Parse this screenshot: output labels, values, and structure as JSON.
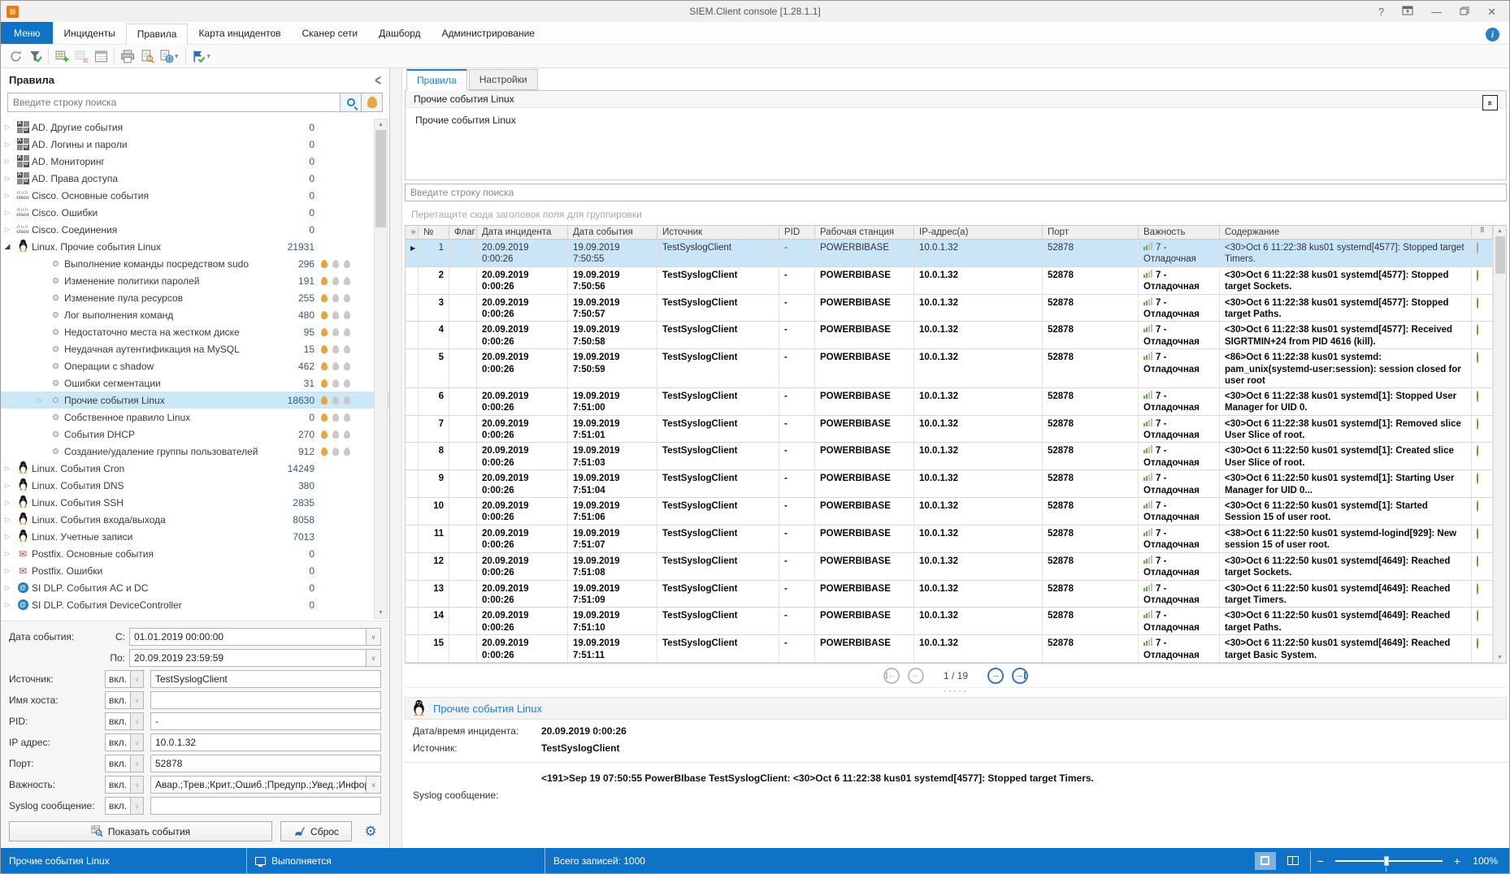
{
  "window": {
    "title": "SIEM.Client console [1.28.1.1]",
    "controls": [
      "help-icon",
      "pin-window-icon",
      "minimize-icon",
      "restore-icon",
      "close-icon"
    ]
  },
  "menu": {
    "tabs": [
      {
        "label": "Меню",
        "kind": "menu"
      },
      {
        "label": "Инциденты"
      },
      {
        "label": "Правила",
        "selected": true
      },
      {
        "label": "Карта инцидентов"
      },
      {
        "label": "Сканер сети"
      },
      {
        "label": "Дашборд"
      },
      {
        "label": "Администрирование"
      }
    ],
    "info_icon": "i"
  },
  "toolbar": {
    "icons": [
      {
        "name": "refresh-icon"
      },
      {
        "name": "filter-check-icon"
      },
      {
        "name": "add-grid-icon",
        "sep_before": true
      },
      {
        "name": "delete-grid-icon",
        "disabled": true
      },
      {
        "name": "card-view-icon"
      },
      {
        "name": "print-icon",
        "sep_before": true
      },
      {
        "name": "print-preview-icon"
      },
      {
        "name": "export-globe-icon",
        "dropdown": true
      },
      {
        "name": "apply-check-icon",
        "sep_before": true,
        "dropdown": true
      }
    ]
  },
  "sidebar": {
    "title": "Правила",
    "search_placeholder": "Введите строку поиска",
    "tree": [
      {
        "label": "AD. Другие события",
        "count": "0",
        "icon": "ad-icon",
        "level": 0,
        "expandable": true
      },
      {
        "label": "AD. Логины и пароли",
        "count": "0",
        "icon": "ad-icon",
        "level": 0,
        "expandable": true
      },
      {
        "label": "AD. Мониторинг",
        "count": "0",
        "icon": "ad-icon",
        "level": 0,
        "expandable": true
      },
      {
        "label": "AD. Права доступа",
        "count": "0",
        "icon": "ad-icon",
        "level": 0,
        "expandable": true
      },
      {
        "label": "Cisco. Основные события",
        "count": "0",
        "icon": "cisco-icon",
        "level": 0,
        "expandable": true
      },
      {
        "label": "Cisco. Ошибки",
        "count": "0",
        "icon": "cisco-icon",
        "level": 0,
        "expandable": true
      },
      {
        "label": "Cisco. Соединения",
        "count": "0",
        "icon": "cisco-icon",
        "level": 0,
        "expandable": true
      },
      {
        "label": "Linux. Прочие события Linux",
        "count": "21931",
        "icon": "linux-icon",
        "level": 0,
        "expandable": true,
        "expanded": true
      },
      {
        "label": "Выполнение команды посредством sudo",
        "count": "296",
        "icon": "rule-dot-icon",
        "level": 1,
        "flames": 1
      },
      {
        "label": "Изменение политики паролей",
        "count": "191",
        "icon": "rule-dot-icon",
        "level": 1,
        "flames": 1
      },
      {
        "label": "Изменение пула ресурсов",
        "count": "255",
        "icon": "rule-dot-icon",
        "level": 1,
        "flames": 1
      },
      {
        "label": "Лог выполнения команд",
        "count": "480",
        "icon": "rule-dot-icon",
        "level": 1,
        "flames": 1
      },
      {
        "label": "Недостаточно места на жестком диске",
        "count": "95",
        "icon": "rule-dot-icon",
        "level": 1,
        "flames": 1
      },
      {
        "label": "Неудачная аутентификация на MySQL",
        "count": "15",
        "icon": "rule-dot-icon",
        "level": 1,
        "flames": 1
      },
      {
        "label": "Операции с shadow",
        "count": "462",
        "icon": "rule-dot-icon",
        "level": 1,
        "flames": 1
      },
      {
        "label": "Ошибки сегментации",
        "count": "31",
        "icon": "rule-dot-icon",
        "level": 1,
        "flames": 1
      },
      {
        "label": "Прочие события Linux",
        "count": "18630",
        "icon": "rule-dot-icon",
        "level": 1,
        "flames": 1,
        "selected": true,
        "expandable": true
      },
      {
        "label": "Собственное правило Linux",
        "count": "0",
        "icon": "rule-dot-icon",
        "level": 1,
        "flames": 1
      },
      {
        "label": "События DHCP",
        "count": "270",
        "icon": "rule-dot-icon",
        "level": 1,
        "flames": 1
      },
      {
        "label": "Создание/удаление группы пользователей",
        "count": "912",
        "icon": "rule-dot-icon",
        "level": 1,
        "flames": 1
      },
      {
        "label": "Linux. События Cron",
        "count": "14249",
        "icon": "linux-icon",
        "level": 0,
        "expandable": true
      },
      {
        "label": "Linux. События DNS",
        "count": "380",
        "icon": "linux-icon",
        "level": 0,
        "expandable": true
      },
      {
        "label": "Linux. События SSH",
        "count": "2835",
        "icon": "linux-icon",
        "level": 0,
        "expandable": true
      },
      {
        "label": "Linux. События входа/выхода",
        "count": "8058",
        "icon": "linux-icon",
        "level": 0,
        "expandable": true
      },
      {
        "label": "Linux. Учетные записи",
        "count": "7013",
        "icon": "linux-icon",
        "level": 0,
        "expandable": true
      },
      {
        "label": "Postfix. Основные события",
        "count": "0",
        "icon": "postfix-icon",
        "level": 0,
        "expandable": true
      },
      {
        "label": "Postfix. Ошибки",
        "count": "0",
        "icon": "postfix-icon",
        "level": 0,
        "expandable": true
      },
      {
        "label": "SI DLP. События AC и DC",
        "count": "0",
        "icon": "sidlp-icon",
        "level": 0,
        "expandable": true
      },
      {
        "label": "SI DLP. События DeviceController",
        "count": "0",
        "icon": "sidlp-icon",
        "level": 0,
        "expandable": true
      }
    ],
    "filters": {
      "date_label": "Дата события:",
      "from_label": "C:",
      "from_value": "01.01.2019 00:00:00",
      "to_label": "По:",
      "to_value": "20.09.2019 23:59:59",
      "toggle_value": "вкл.",
      "rows": [
        {
          "label": "Источник:",
          "value": "TestSyslogClient"
        },
        {
          "label": "Имя хоста:",
          "value": ""
        },
        {
          "label": "PID:",
          "value": "-"
        },
        {
          "label": "IP адрес:",
          "value": "10.0.1.32"
        },
        {
          "label": "Порт:",
          "value": "52878"
        },
        {
          "label": "Важность:",
          "value": "Авар.;Трев.;Крит.;Ошиб.;Предупр.;Увед.;Информ",
          "dropdown": true
        },
        {
          "label": "Syslog сообщение:",
          "value": ""
        }
      ],
      "show_button": "Показать события",
      "reset_button": "Сброс"
    }
  },
  "main": {
    "tabs": [
      {
        "label": "Правила",
        "selected": true
      },
      {
        "label": "Настройки"
      }
    ],
    "rule_header": "Прочие события Linux",
    "rule_body": "Прочие события Linux",
    "search_placeholder": "Введите строку поиска",
    "group_hint": "Перетащите сюда заголовок поля для группировки",
    "table": {
      "columns": [
        "№",
        "Флаг",
        "Дата инцидента",
        "Дата события",
        "Источник",
        "PID",
        "Рабочая станция",
        "IP-адрес(а)",
        "Порт",
        "Важность",
        "Содержание"
      ],
      "rows": [
        {
          "num": "1",
          "incident": "20.09.2019 0:00:26",
          "event": "19.09.2019 7:50:55",
          "source": "TestSyslogClient",
          "pid": "-",
          "station": "POWERBIBASE",
          "ip": "10.0.1.32",
          "port": "52878",
          "severity": "7 - Отладочная",
          "content": "<30>Oct  6 11:22:38 kus01 systemd[4577]: Stopped target Timers.",
          "selected": true
        },
        {
          "num": "2",
          "incident": "20.09.2019 0:00:26",
          "event": "19.09.2019 7:50:56",
          "source": "TestSyslogClient",
          "pid": "-",
          "station": "POWERBIBASE",
          "ip": "10.0.1.32",
          "port": "52878",
          "severity": "7 - Отладочная",
          "content": "<30>Oct  6 11:22:38 kus01 systemd[4577]: Stopped target Sockets."
        },
        {
          "num": "3",
          "incident": "20.09.2019 0:00:26",
          "event": "19.09.2019 7:50:57",
          "source": "TestSyslogClient",
          "pid": "-",
          "station": "POWERBIBASE",
          "ip": "10.0.1.32",
          "port": "52878",
          "severity": "7 - Отладочная",
          "content": "<30>Oct  6 11:22:38 kus01 systemd[4577]: Stopped target Paths."
        },
        {
          "num": "4",
          "incident": "20.09.2019 0:00:26",
          "event": "19.09.2019 7:50:58",
          "source": "TestSyslogClient",
          "pid": "-",
          "station": "POWERBIBASE",
          "ip": "10.0.1.32",
          "port": "52878",
          "severity": "7 - Отладочная",
          "content": "<30>Oct  6 11:22:38 kus01 systemd[4577]: Received SIGRTMIN+24 from PID 4616 (kill)."
        },
        {
          "num": "5",
          "incident": "20.09.2019 0:00:26",
          "event": "19.09.2019 7:50:59",
          "source": "TestSyslogClient",
          "pid": "-",
          "station": "POWERBIBASE",
          "ip": "10.0.1.32",
          "port": "52878",
          "severity": "7 - Отладочная",
          "content": "<86>Oct  6 11:22:38 kus01 systemd: pam_unix(systemd-user:session): session closed for user root"
        },
        {
          "num": "6",
          "incident": "20.09.2019 0:00:26",
          "event": "19.09.2019 7:51:00",
          "source": "TestSyslogClient",
          "pid": "-",
          "station": "POWERBIBASE",
          "ip": "10.0.1.32",
          "port": "52878",
          "severity": "7 - Отладочная",
          "content": "<30>Oct  6 11:22:38 kus01 systemd[1]: Stopped User Manager for UID 0."
        },
        {
          "num": "7",
          "incident": "20.09.2019 0:00:26",
          "event": "19.09.2019 7:51:01",
          "source": "TestSyslogClient",
          "pid": "-",
          "station": "POWERBIBASE",
          "ip": "10.0.1.32",
          "port": "52878",
          "severity": "7 - Отладочная",
          "content": "<30>Oct  6 11:22:38 kus01 systemd[1]: Removed slice User Slice of root."
        },
        {
          "num": "8",
          "incident": "20.09.2019 0:00:26",
          "event": "19.09.2019 7:51:03",
          "source": "TestSyslogClient",
          "pid": "-",
          "station": "POWERBIBASE",
          "ip": "10.0.1.32",
          "port": "52878",
          "severity": "7 - Отладочная",
          "content": "<30>Oct  6 11:22:50 kus01 systemd[1]: Created slice User Slice of root."
        },
        {
          "num": "9",
          "incident": "20.09.2019 0:00:26",
          "event": "19.09.2019 7:51:04",
          "source": "TestSyslogClient",
          "pid": "-",
          "station": "POWERBIBASE",
          "ip": "10.0.1.32",
          "port": "52878",
          "severity": "7 - Отладочная",
          "content": "<30>Oct  6 11:22:50 kus01 systemd[1]: Starting User Manager for UID 0..."
        },
        {
          "num": "10",
          "incident": "20.09.2019 0:00:26",
          "event": "19.09.2019 7:51:06",
          "source": "TestSyslogClient",
          "pid": "-",
          "station": "POWERBIBASE",
          "ip": "10.0.1.32",
          "port": "52878",
          "severity": "7 - Отладочная",
          "content": "<30>Oct  6 11:22:50 kus01 systemd[1]: Started Session 15 of user root."
        },
        {
          "num": "11",
          "incident": "20.09.2019 0:00:26",
          "event": "19.09.2019 7:51:07",
          "source": "TestSyslogClient",
          "pid": "-",
          "station": "POWERBIBASE",
          "ip": "10.0.1.32",
          "port": "52878",
          "severity": "7 - Отладочная",
          "content": "<38>Oct  6 11:22:50 kus01 systemd-logind[929]: New session 15 of user root."
        },
        {
          "num": "12",
          "incident": "20.09.2019 0:00:26",
          "event": "19.09.2019 7:51:08",
          "source": "TestSyslogClient",
          "pid": "-",
          "station": "POWERBIBASE",
          "ip": "10.0.1.32",
          "port": "52878",
          "severity": "7 - Отладочная",
          "content": "<30>Oct  6 11:22:50 kus01 systemd[4649]: Reached target Sockets."
        },
        {
          "num": "13",
          "incident": "20.09.2019 0:00:26",
          "event": "19.09.2019 7:51:09",
          "source": "TestSyslogClient",
          "pid": "-",
          "station": "POWERBIBASE",
          "ip": "10.0.1.32",
          "port": "52878",
          "severity": "7 - Отладочная",
          "content": "<30>Oct  6 11:22:50 kus01 systemd[4649]: Reached target Timers."
        },
        {
          "num": "14",
          "incident": "20.09.2019 0:00:26",
          "event": "19.09.2019 7:51:10",
          "source": "TestSyslogClient",
          "pid": "-",
          "station": "POWERBIBASE",
          "ip": "10.0.1.32",
          "port": "52878",
          "severity": "7 - Отладочная",
          "content": "<30>Oct  6 11:22:50 kus01 systemd[4649]: Reached target Paths."
        },
        {
          "num": "15",
          "incident": "20.09.2019 0:00:26",
          "event": "19.09.2019 7:51:11",
          "source": "TestSyslogClient",
          "pid": "-",
          "station": "POWERBIBASE",
          "ip": "10.0.1.32",
          "port": "52878",
          "severity": "7 - Отладочная",
          "content": "<30>Oct  6 11:22:50 kus01 systemd[4649]: Reached target Basic System."
        }
      ]
    },
    "pager": {
      "page_label": "1 / 19"
    },
    "detail": {
      "title": "Прочие события Linux",
      "incident_label": "Дата/время инцидента:",
      "incident_value": "20.09.2019 0:00:26",
      "source_label": "Источник:",
      "source_value": "TestSyslogClient",
      "message": "<191>Sep 19 07:50:55 PowerBIbase TestSyslogClient: <30>Oct  6 11:22:38 kus01 systemd[4577]: Stopped target Timers.",
      "syslog_label": "Syslog сообщение:"
    }
  },
  "statusbar": {
    "context": "Прочие события Linux",
    "state": "Выполняется",
    "total": "Всего записей: 1000",
    "zoom_value": "100%",
    "colors": {
      "bar": "#0e72c6",
      "accent": "#1c7fd5",
      "selection": "#cbe8f6",
      "flame": "#e9a33f",
      "link_dot": "#8fbf3f"
    }
  }
}
